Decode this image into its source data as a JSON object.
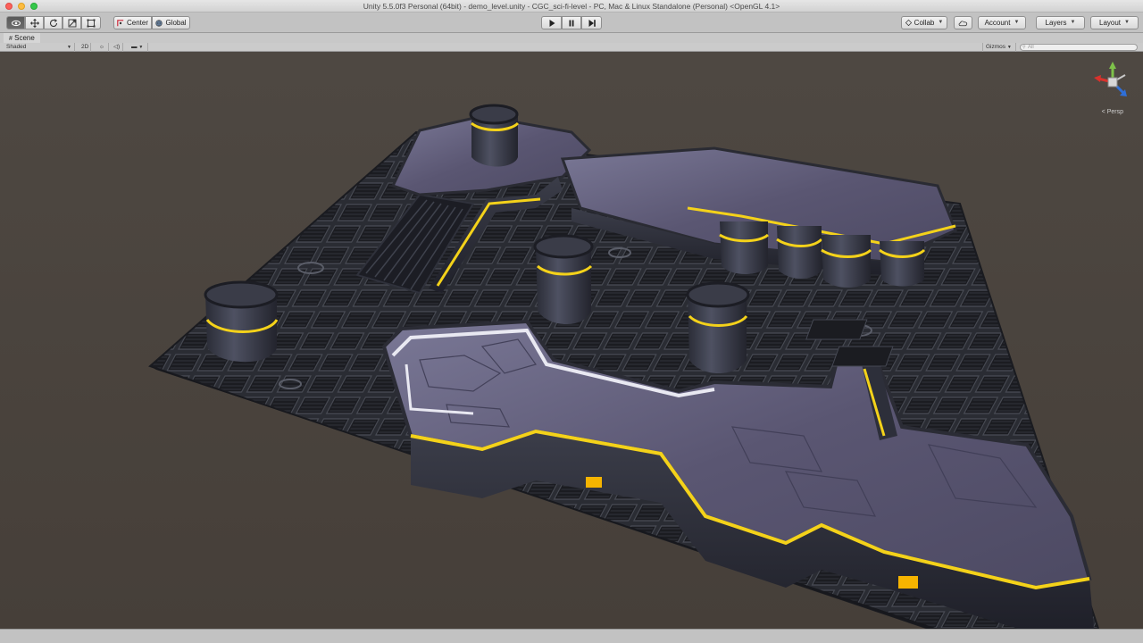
{
  "window": {
    "title": "Unity 5.5.0f3 Personal (64bit) - demo_level.unity - CGC_sci-fi-level - PC, Mac & Linux Standalone (Personal) <OpenGL 4.1>"
  },
  "toolbar": {
    "pivot_label": "Center",
    "space_label": "Global",
    "collab_label": "Collab",
    "account_label": "Account",
    "layers_label": "Layers",
    "layout_label": "Layout"
  },
  "scene": {
    "tab_label": "Scene",
    "shading_mode": "Shaded",
    "twod_label": "2D",
    "gizmos_label": "Gizmos",
    "search_placeholder": "All",
    "projection_label": "Persp"
  },
  "colors": {
    "accent_yellow": "#f4d21a",
    "floor_dark": "#25272f",
    "panel_purple": "#5e5a78",
    "scene_background": "#4b453f"
  }
}
